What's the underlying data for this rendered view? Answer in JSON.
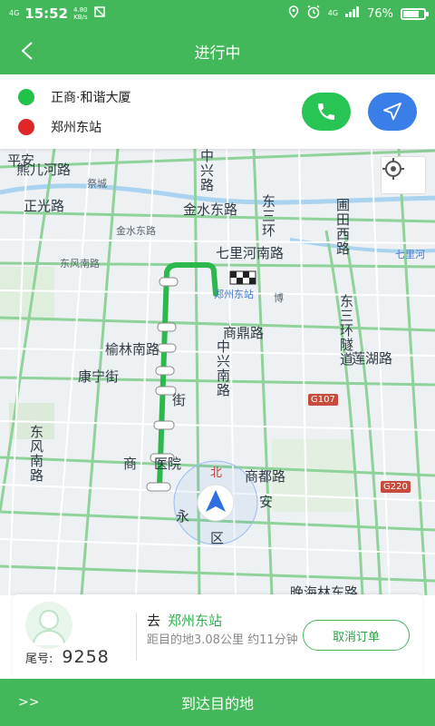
{
  "status_bar": {
    "network": "4G",
    "time": "15:52",
    "speed_value": "4.80",
    "speed_unit": "KB/s",
    "network_right": "4G",
    "battery_percent": "76%",
    "battery_level": 0.76
  },
  "header": {
    "title": "进行中",
    "back_icon": "chevron-left-icon"
  },
  "route": {
    "origin": "正商·和谐大厦",
    "destination": "郑州东站",
    "origin_color": "#22c24a",
    "destination_color": "#e02727",
    "call_icon": "phone-icon",
    "navigate_icon": "navigation-arrow-icon"
  },
  "map": {
    "labels": {
      "pingan": "平安",
      "xionger": "熊儿河路",
      "caicheng": "祭城",
      "zhongxing_n": "中兴路",
      "zhengguang": "正光路",
      "jinshui_east": "金水东路",
      "dongsan_top": "东三环",
      "jinshui_small": "金水东路",
      "putian": "圃田西路",
      "qili_small": "七里河",
      "qili": "七里河南路",
      "dongfeng_small": "东风南路",
      "zhengzhou_station": "郑州东站",
      "shangding": "商鼎路",
      "dongsan_tunnel": "东三环隧道",
      "yulin": "榆林南路",
      "lianhu": "莲湖路",
      "kangning": "康宁街",
      "zhongxing_s": "中兴南路",
      "dongfeng_nan": "东风南路",
      "shangdu": "商都路",
      "yuan": "医院",
      "jie": "街",
      "bei": "北",
      "yong": "永",
      "shang": "商",
      "an": "安",
      "bottom_road": "晚海林东路",
      "bo": "博",
      "qu": "区",
      "g107": "G107",
      "g220": "G220"
    },
    "locate_icon": "locate-crosshair-icon",
    "vehicle_icon": "navigation-arrow-icon",
    "route_color": "#2db84e",
    "finish_icon": "checkered-flag-icon"
  },
  "driver_card": {
    "avatar_icon": "user-avatar-icon",
    "plate_label": "尾号:",
    "plate_value": "9258",
    "go_label": "去",
    "destination": "郑州东站",
    "distance_info": "距目的地3.08公里 约11分钟",
    "cancel_label": "取消订单"
  },
  "bottom_bar": {
    "slide_arrows": ">>",
    "arrive_label": "到达目的地"
  }
}
